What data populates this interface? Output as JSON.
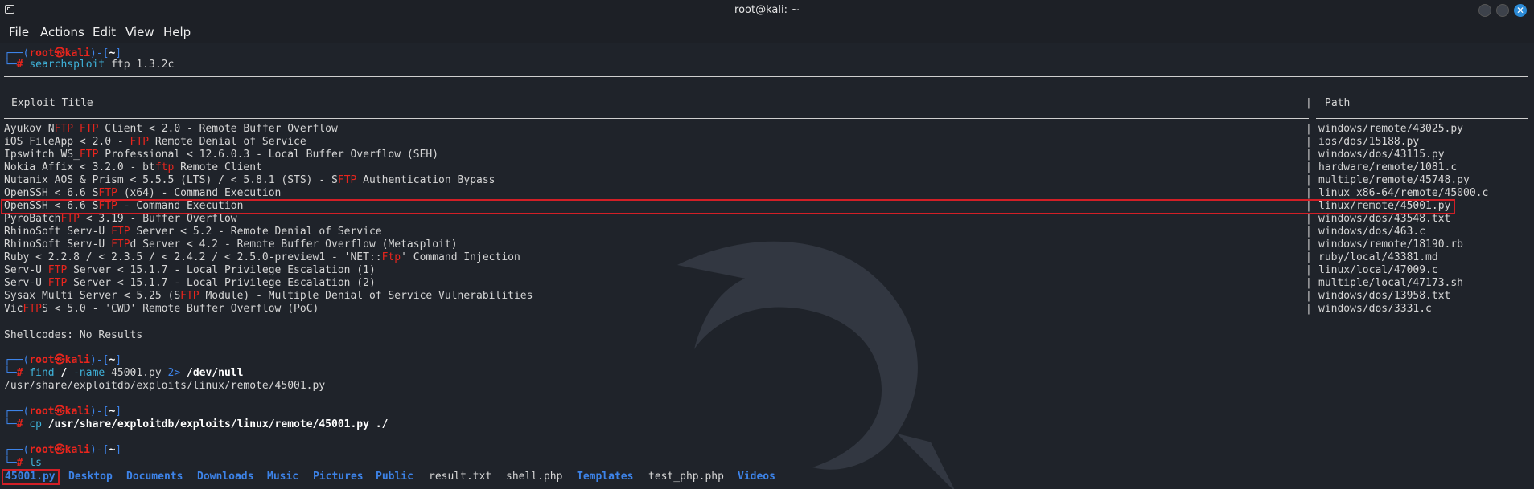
{
  "window": {
    "title": "root@kali: ~"
  },
  "menu": {
    "items": [
      "File",
      "Actions",
      "Edit",
      "View",
      "Help"
    ]
  },
  "prompt": {
    "user": "root",
    "host": "kali",
    "at": "㉿",
    "dir": "~"
  },
  "commands": {
    "c1": {
      "cmd": "searchsploit",
      "args": "ftp 1.3.2c"
    },
    "c2": {
      "cmd": "find",
      "p1": "/",
      "p2": "-name",
      "p3": "45001.py",
      "p4": "2>",
      "p5": "/dev/null"
    },
    "c3": {
      "cmd": "cp",
      "args": "/usr/share/exploitdb/exploits/linux/remote/45001.py ./"
    },
    "c4": {
      "cmd": "ls"
    }
  },
  "table": {
    "col_title": "Exploit Title",
    "col_path": "Path",
    "rows": [
      {
        "pre": "Ayukov N",
        "hl": "FTP FTP",
        "post": " Client < 2.0 - Remote Buffer Overflow",
        "path": "windows/remote/43025.py"
      },
      {
        "pre": "iOS FileApp < 2.0 - ",
        "hl": "FTP",
        "post": " Remote Denial of Service",
        "path": "ios/dos/15188.py"
      },
      {
        "pre": "Ipswitch WS_",
        "hl": "FTP",
        "post": " Professional < 12.6.0.3 - Local Buffer Overflow (SEH)",
        "path": "windows/dos/43115.py"
      },
      {
        "pre": "Nokia Affix < 3.2.0 - bt",
        "hl": "ftp",
        "post": " Remote Client",
        "path": "hardware/remote/1081.c"
      },
      {
        "pre": "Nutanix AOS & Prism < 5.5.5 (LTS) / < 5.8.1 (STS) - S",
        "hl": "FTP",
        "post": " Authentication Bypass",
        "path": "multiple/remote/45748.py"
      },
      {
        "pre": "OpenSSH < 6.6 S",
        "hl": "FTP",
        "post": " (x64) - Command Execution",
        "path": "linux_x86-64/remote/45000.c"
      },
      {
        "pre": "OpenSSH < 6.6 S",
        "hl": "FTP",
        "post": " - Command Execution",
        "path": "linux/remote/45001.py"
      },
      {
        "pre": "PyroBatch",
        "hl": "FTP",
        "post": " < 3.19 - Buffer Overflow",
        "path": "windows/dos/43548.txt"
      },
      {
        "pre": "RhinoSoft Serv-U ",
        "hl": "FTP",
        "post": " Server < 5.2 - Remote Denial of Service",
        "path": "windows/dos/463.c"
      },
      {
        "pre": "RhinoSoft Serv-U ",
        "hl": "FTP",
        "post": "d Server < 4.2 - Remote Buffer Overflow (Metasploit)",
        "path": "windows/remote/18190.rb"
      },
      {
        "pre": "Ruby < 2.2.8 / < 2.3.5 / < 2.4.2 / < 2.5.0-preview1 - 'NET::",
        "hl": "Ftp",
        "post": "' Command Injection",
        "path": "ruby/local/43381.md"
      },
      {
        "pre": "Serv-U ",
        "hl": "FTP",
        "post": " Server < 15.1.7 - Local Privilege Escalation (1)",
        "path": "linux/local/47009.c"
      },
      {
        "pre": "Serv-U ",
        "hl": "FTP",
        "post": " Server < 15.1.7 - Local Privilege Escalation (2)",
        "path": "multiple/local/47173.sh"
      },
      {
        "pre": "Sysax Multi Server < 5.25 (S",
        "hl": "FTP",
        "post": " Module) - Multiple Denial of Service Vulnerabilities",
        "path": "windows/dos/13958.txt"
      },
      {
        "pre": "Vic",
        "hl": "FTP",
        "post": "S < 5.0 - 'CWD' Remote Buffer Overflow (PoC)",
        "path": "windows/dos/3331.c"
      }
    ]
  },
  "output": {
    "shellcodes": "Shellcodes: No Results",
    "find_result": "/usr/share/exploitdb/exploits/linux/remote/45001.py"
  },
  "ls": [
    {
      "name": "45001.py",
      "kind": "file-boxed"
    },
    {
      "name": "Desktop",
      "kind": "dir"
    },
    {
      "name": "Documents",
      "kind": "dir"
    },
    {
      "name": "Downloads",
      "kind": "dir"
    },
    {
      "name": "Music",
      "kind": "dir"
    },
    {
      "name": "Pictures",
      "kind": "dir"
    },
    {
      "name": "Public",
      "kind": "dir"
    },
    {
      "name": "result.txt",
      "kind": "file"
    },
    {
      "name": "shell.php",
      "kind": "file"
    },
    {
      "name": "Templates",
      "kind": "dir"
    },
    {
      "name": "test_php.php",
      "kind": "file"
    },
    {
      "name": "Videos",
      "kind": "dir"
    }
  ]
}
